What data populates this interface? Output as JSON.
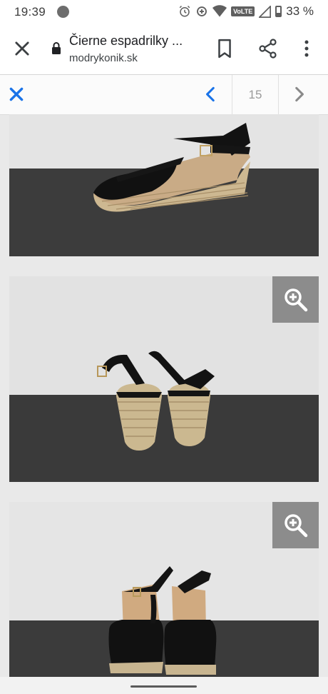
{
  "status_bar": {
    "time": "19:39",
    "network": "VoLTE",
    "battery": "33 %",
    "icons": [
      "app-notification-icon",
      "alarm-icon",
      "data-saver-icon",
      "wifi-icon",
      "signal-icon",
      "battery-icon"
    ]
  },
  "toolbar": {
    "page_title": "Čierne espadrilky ...",
    "url": "modrykonik.sk",
    "icons": [
      "close-icon",
      "lock-icon",
      "bookmark-icon",
      "share-icon",
      "more-vert-icon"
    ]
  },
  "gallery": {
    "counter": "15",
    "icons": [
      "close-gallery-icon",
      "chevron-left-icon",
      "chevron-right-icon",
      "zoom-in-icon"
    ],
    "accent_color": "#1a73e8",
    "photos": [
      {
        "subject": "black espadrille wedge sandal, side view",
        "zoom_button": false
      },
      {
        "subject": "black espadrille wedge sandals, back view",
        "zoom_button": true
      },
      {
        "subject": "black espadrille wedge sandals, front view",
        "zoom_button": true
      }
    ]
  }
}
